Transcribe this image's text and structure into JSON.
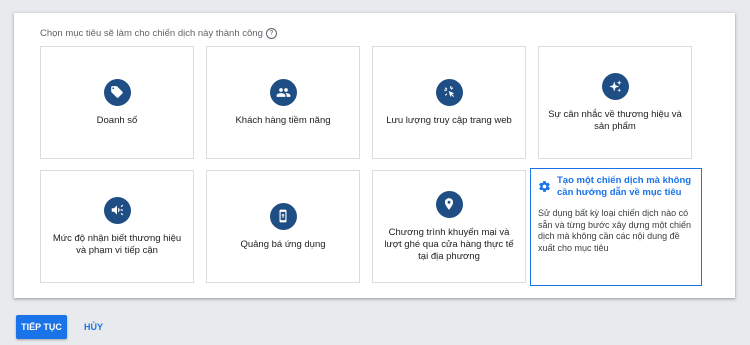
{
  "prompt": {
    "text": "Chọn mục tiêu sẽ làm cho chiến dịch này thành công",
    "help_icon": "?"
  },
  "goals": [
    {
      "label": "Doanh số",
      "icon": "tag-icon"
    },
    {
      "label": "Khách hàng tiềm năng",
      "icon": "people-icon"
    },
    {
      "label": "Lưu lượng truy cập trang web",
      "icon": "cursor-click-icon"
    },
    {
      "label": "Sự cân nhắc về thương hiệu và sản phẩm",
      "icon": "sparkle-icon"
    },
    {
      "label": "Mức độ nhận biết thương hiệu và phạm vi tiếp cận",
      "icon": "megaphone-icon"
    },
    {
      "label": "Quảng bá ứng dụng",
      "icon": "phone-icon"
    },
    {
      "label": "Chương trình khuyến mại và lượt ghé qua cửa hàng thực tế tại địa phương",
      "icon": "location-pin-icon"
    }
  ],
  "no_goal": {
    "title": "Tạo một chiến dịch mà không cần hướng dẫn về mục tiêu",
    "description": "Sử dụng bất kỳ loại chiến dịch nào có sẵn và từng bước xây dựng một chiến dịch mà không cần các nội dung đề xuất cho mục tiêu",
    "icon": "gear-icon"
  },
  "actions": {
    "continue_label": "TIẾP TỤC",
    "cancel_label": "HỦY"
  },
  "colors": {
    "accent": "#1a73e8",
    "icon_circle": "#1f4e85"
  }
}
